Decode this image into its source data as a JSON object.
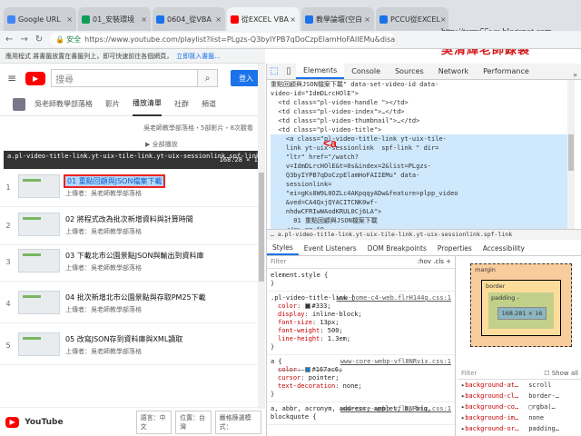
{
  "browser": {
    "tabs": [
      {
        "label": "Google URL",
        "color": "#4285f4"
      },
      {
        "label": "01_安裝環境",
        "color": "#0f9d58"
      },
      {
        "label": "0604_從VBA",
        "color": "#1a73e8"
      },
      {
        "label": "從EXCEL VBA",
        "color": "#ff0000"
      },
      {
        "label": "教學論壇(空白",
        "color": "#1a73e8"
      },
      {
        "label": "PCCU從EXCEL",
        "color": "#1a73e8"
      }
    ],
    "url": "https://www.youtube.com/playlist?list=PLgzs-Q3byIYPB7qDoCzpElamHoFAIIEMu&disab",
    "secure_label": "安全",
    "bookmarks_text": "應用程式  將書籤放置在書籤列上，即可快速前往各個網頁，",
    "bookmarks_link": "立即匯入書籤...",
    "watermark_url": "http://terry55wu.blogspot.com",
    "watermark_name": "吳清輝老師錄製"
  },
  "youtube": {
    "search_placeholder": "搜尋",
    "signin": "登入",
    "channel_tabs": [
      "吳老師教學部落格",
      "影片",
      "播放清單",
      "社群",
      "頻道"
    ],
    "selected_tab": "播放清單",
    "subinfo": "吳老師教學部落格・5部影片・8次觀看",
    "pl_buttons": "全部播放",
    "tooltip_selector": "a.pl-video-title-link.yt-uix-tile-link.yt-uix-sessionlink.spf-link",
    "tooltip_size": "168.28 × 16",
    "videos": [
      {
        "index": "1",
        "title": "01 重點回顧與JSON檔案下載",
        "uploader": "上傳者：吳老師教學部落格"
      },
      {
        "index": "2",
        "title": "02 將程式改為批次新增資料與計算時間",
        "uploader": "上傳者：吳老師教學部落格"
      },
      {
        "index": "3",
        "title": "03 下載北市公園景點JSON與輸出到資料庫",
        "uploader": "上傳者：吳老師教學部落格"
      },
      {
        "index": "4",
        "title": "04 批次新增北市公園景點與存取PM25下載",
        "uploader": "上傳者：吳老師教學部落格"
      },
      {
        "index": "5",
        "title": "05 改寫JSON存到資料庫與XML讀取",
        "uploader": "上傳者：吳老師教學部落格"
      }
    ],
    "footer_logo": "YouTube",
    "footer_buttons": [
      "語言：中文",
      "位置：台灣",
      "嚴格篩選模式："
    ]
  },
  "devtools": {
    "tabs": [
      "Elements",
      "Console",
      "Sources",
      "Network",
      "Performance"
    ],
    "selected_tab": "Elements",
    "more": "»",
    "dom_lines": [
      "重點回顧與JSON檔案下載\" data-set-video-id data-",
      "video-id=\"IdmDLrcHOlE\">",
      "  <td class=\"pl-video-handle \"></td>",
      "  <td class=\"pl-video-index\">…</td>",
      "  <td class=\"pl-video-thumbnail\">…</td>",
      "  <td class=\"pl-video-title\">"
    ],
    "selected_lines": [
      "    <a class=\"pl-video-title-link yt-uix-tile-",
      "    link yt-uix-sessionlink  spf-link \" dir=",
      "    \"ltr\" href=\"/watch?",
      "    v=IdmDLrcHOlE&t=0s&index=2&list=PLgzs-",
      "    Q3byIYPB7qDoCzpElamHoFAIIEMu\" data-",
      "    sessionlink=",
      "    \"ei=gKs8W9L0OZLc4AKpqqyADw&feature=plpp_video",
      "    &ved=CA4QxjQYACITCNK0wf-",
      "    nhdwCFRIwWAodKRUL0Cj6LA\">",
      "      01 重點回顧與JSON檔案下載",
      "    </a> == $0"
    ],
    "annotation": "<a",
    "breadcrumb": "… a.pl-video-title-link.yt-uix-tile-link.yt-uix-sessionlink.spf-link",
    "style_tabs": [
      "Styles",
      "Event Listeners",
      "DOM Breakpoints",
      "Properties",
      "Accessibility"
    ],
    "filter_placeholder": "Filter",
    "filter_right": ":hov  .cls  +",
    "rules": [
      {
        "selector": "element.style {",
        "source": "",
        "props": [],
        "close": "}"
      },
      {
        "selector": ".pl-video-title-link {",
        "source": "www-home-c4-web.flrH144g.css:1",
        "props": [
          {
            "name": "color",
            "value": "#333;",
            "swatch": "#333333",
            "strike": false
          },
          {
            "name": "display",
            "value": "inline-block;",
            "swatch": "",
            "strike": false
          },
          {
            "name": "font-size",
            "value": "13px;",
            "swatch": "",
            "strike": false
          },
          {
            "name": "font-weight",
            "value": "500;",
            "swatch": "",
            "strike": false
          },
          {
            "name": "line-height",
            "value": "1.3em;",
            "swatch": "",
            "strike": false
          }
        ],
        "close": "}"
      },
      {
        "selector": "a {",
        "source": "www-core-webp-vfl8NRvix.css:1",
        "props": [
          {
            "name": "color",
            "value": "#167ac6;",
            "swatch": "#167ac6",
            "strike": true
          },
          {
            "name": "cursor",
            "value": "pointer;",
            "swatch": "",
            "strike": false
          },
          {
            "name": "text-decoration",
            "value": "none;",
            "swatch": "",
            "strike": false
          }
        ],
        "close": "}"
      },
      {
        "selector": "a, abbr, acronym, address, applet, b, big, blockquote {",
        "source": "www-core-webp-vfl8NRvix.css:1",
        "props": [],
        "close": ""
      }
    ],
    "boxmodel": {
      "margin": "margin",
      "border": "border",
      "padding": "padding -",
      "content": "168.281 × 16",
      "dash": "-"
    },
    "computed_filter": "Filter",
    "show_all": "Show all",
    "computed": [
      {
        "name": "background-at…",
        "value": "scroll"
      },
      {
        "name": "background-cl…",
        "value": "border-…"
      },
      {
        "name": "background-co…",
        "value": "▢rgba(…"
      },
      {
        "name": "background-im…",
        "value": "none"
      },
      {
        "name": "background-or…",
        "value": "padding…"
      }
    ]
  }
}
